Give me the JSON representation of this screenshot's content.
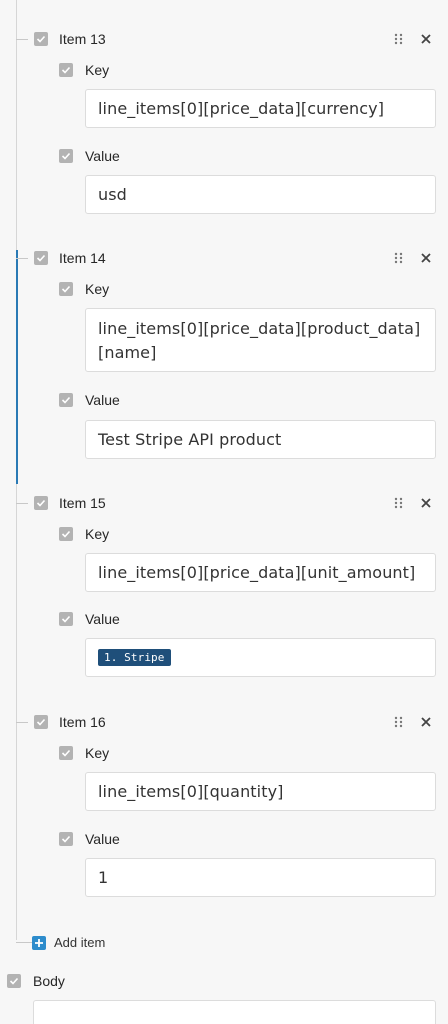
{
  "items": [
    {
      "title": "Item 13",
      "key_label": "Key",
      "key_value": "line_items[0][price_data][currency]",
      "value_label": "Value",
      "value_value": "usd"
    },
    {
      "title": "Item 14",
      "key_label": "Key",
      "key_value": "line_items[0][price_data][product_data][name]",
      "value_label": "Value",
      "value_value": "Test Stripe API product"
    },
    {
      "title": "Item 15",
      "key_label": "Key",
      "key_value": "line_items[0][price_data][unit_amount]",
      "value_label": "Value",
      "value_token": "1. Stripe"
    },
    {
      "title": "Item 16",
      "key_label": "Key",
      "key_value": "line_items[0][quantity]",
      "value_label": "Value",
      "value_value": "1"
    }
  ],
  "add_item_label": "Add item",
  "body_label": "Body",
  "colors": {
    "accent": "#2a7ab5",
    "token_bg": "#1f4f7a",
    "checkbox": "#b3b3b3"
  }
}
